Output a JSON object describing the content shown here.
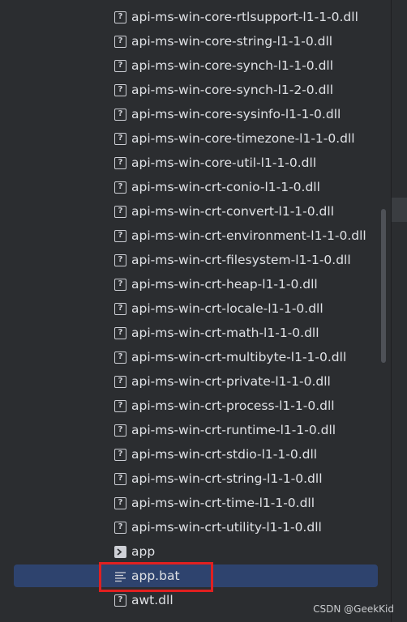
{
  "files": [
    {
      "name": "api-ms-win-core-rtlsupport-l1-1-0.dll",
      "icon": "unknown-file-icon"
    },
    {
      "name": "api-ms-win-core-string-l1-1-0.dll",
      "icon": "unknown-file-icon"
    },
    {
      "name": "api-ms-win-core-synch-l1-1-0.dll",
      "icon": "unknown-file-icon"
    },
    {
      "name": "api-ms-win-core-synch-l1-2-0.dll",
      "icon": "unknown-file-icon"
    },
    {
      "name": "api-ms-win-core-sysinfo-l1-1-0.dll",
      "icon": "unknown-file-icon"
    },
    {
      "name": "api-ms-win-core-timezone-l1-1-0.dll",
      "icon": "unknown-file-icon"
    },
    {
      "name": "api-ms-win-core-util-l1-1-0.dll",
      "icon": "unknown-file-icon"
    },
    {
      "name": "api-ms-win-crt-conio-l1-1-0.dll",
      "icon": "unknown-file-icon"
    },
    {
      "name": "api-ms-win-crt-convert-l1-1-0.dll",
      "icon": "unknown-file-icon"
    },
    {
      "name": "api-ms-win-crt-environment-l1-1-0.dll",
      "icon": "unknown-file-icon"
    },
    {
      "name": "api-ms-win-crt-filesystem-l1-1-0.dll",
      "icon": "unknown-file-icon"
    },
    {
      "name": "api-ms-win-crt-heap-l1-1-0.dll",
      "icon": "unknown-file-icon"
    },
    {
      "name": "api-ms-win-crt-locale-l1-1-0.dll",
      "icon": "unknown-file-icon"
    },
    {
      "name": "api-ms-win-crt-math-l1-1-0.dll",
      "icon": "unknown-file-icon"
    },
    {
      "name": "api-ms-win-crt-multibyte-l1-1-0.dll",
      "icon": "unknown-file-icon"
    },
    {
      "name": "api-ms-win-crt-private-l1-1-0.dll",
      "icon": "unknown-file-icon"
    },
    {
      "name": "api-ms-win-crt-process-l1-1-0.dll",
      "icon": "unknown-file-icon"
    },
    {
      "name": "api-ms-win-crt-runtime-l1-1-0.dll",
      "icon": "unknown-file-icon"
    },
    {
      "name": "api-ms-win-crt-stdio-l1-1-0.dll",
      "icon": "unknown-file-icon"
    },
    {
      "name": "api-ms-win-crt-string-l1-1-0.dll",
      "icon": "unknown-file-icon"
    },
    {
      "name": "api-ms-win-crt-time-l1-1-0.dll",
      "icon": "unknown-file-icon"
    },
    {
      "name": "api-ms-win-crt-utility-l1-1-0.dll",
      "icon": "unknown-file-icon"
    },
    {
      "name": "app",
      "icon": "executable-file-icon"
    },
    {
      "name": "app.bat",
      "icon": "text-file-icon",
      "selected": true
    },
    {
      "name": "awt.dll",
      "icon": "unknown-file-icon"
    }
  ],
  "watermark": "CSDN @GeekKid",
  "colors": {
    "background": "#2b2d30",
    "selection": "#2e436e",
    "text": "#dfe1e5",
    "highlight_box": "#e02020"
  }
}
